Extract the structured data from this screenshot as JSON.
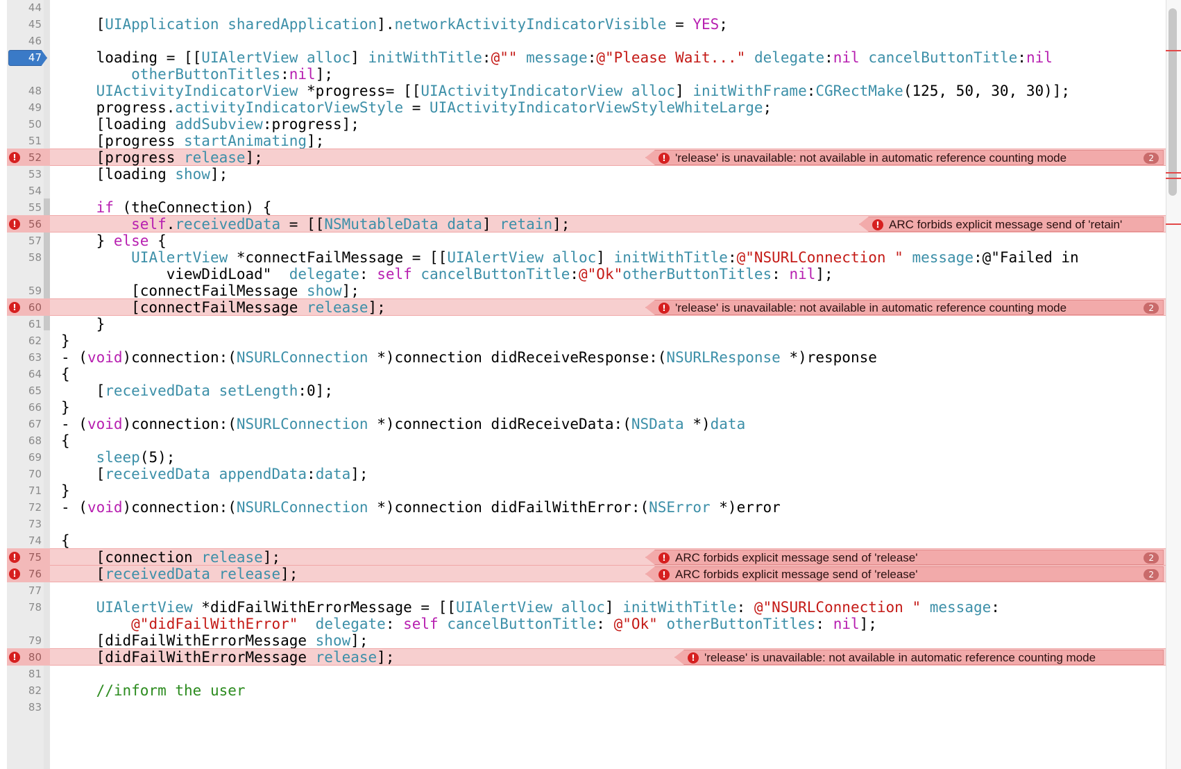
{
  "editor": {
    "lines": [
      {
        "n": "44",
        "code": ""
      },
      {
        "n": "45",
        "code": "    [UIApplication sharedApplication].networkActivityIndicatorVisible = YES;"
      },
      {
        "n": "46",
        "code": ""
      },
      {
        "n": "47",
        "code": "    loading = [[UIAlertView alloc] initWithTitle:@\"\" message:@\"Please Wait...\" delegate:nil cancelButtonTitle:nil"
      },
      {
        "n": "",
        "code": "        otherButtonTitles:nil];"
      },
      {
        "n": "48",
        "code": "    UIActivityIndicatorView *progress= [[UIActivityIndicatorView alloc] initWithFrame:CGRectMake(125, 50, 30, 30)];"
      },
      {
        "n": "49",
        "code": "    progress.activityIndicatorViewStyle = UIActivityIndicatorViewStyleWhiteLarge;"
      },
      {
        "n": "50",
        "code": "    [loading addSubview:progress];"
      },
      {
        "n": "51",
        "code": "    [progress startAnimating];"
      },
      {
        "n": "52",
        "code": "    [progress release];"
      },
      {
        "n": "53",
        "code": "    [loading show];"
      },
      {
        "n": "54",
        "code": ""
      },
      {
        "n": "55",
        "code": "    if (theConnection) {"
      },
      {
        "n": "56",
        "code": "        self.receivedData = [[NSMutableData data] retain];"
      },
      {
        "n": "57",
        "code": "    } else {"
      },
      {
        "n": "58",
        "code": "        UIAlertView *connectFailMessage = [[UIAlertView alloc] initWithTitle:@\"NSURLConnection \" message:@\"Failed in"
      },
      {
        "n": "",
        "code": "            viewDidLoad\"  delegate: self cancelButtonTitle:@\"Ok\"otherButtonTitles: nil];"
      },
      {
        "n": "59",
        "code": "        [connectFailMessage show];"
      },
      {
        "n": "60",
        "code": "        [connectFailMessage release];"
      },
      {
        "n": "61",
        "code": "    }"
      },
      {
        "n": "62",
        "code": "}"
      },
      {
        "n": "63",
        "code": "- (void)connection:(NSURLConnection *)connection didReceiveResponse:(NSURLResponse *)response"
      },
      {
        "n": "64",
        "code": "{"
      },
      {
        "n": "65",
        "code": "    [receivedData setLength:0];"
      },
      {
        "n": "66",
        "code": "}"
      },
      {
        "n": "67",
        "code": "- (void)connection:(NSURLConnection *)connection didReceiveData:(NSData *)data"
      },
      {
        "n": "68",
        "code": "{"
      },
      {
        "n": "69",
        "code": "    sleep(5);"
      },
      {
        "n": "70",
        "code": "    [receivedData appendData:data];"
      },
      {
        "n": "71",
        "code": "}"
      },
      {
        "n": "72",
        "code": "- (void)connection:(NSURLConnection *)connection didFailWithError:(NSError *)error"
      },
      {
        "n": "73",
        "code": ""
      },
      {
        "n": "74",
        "code": "{"
      },
      {
        "n": "75",
        "code": "    [connection release];"
      },
      {
        "n": "76",
        "code": "    [receivedData release];"
      },
      {
        "n": "77",
        "code": ""
      },
      {
        "n": "78",
        "code": "    UIAlertView *didFailWithErrorMessage = [[UIAlertView alloc] initWithTitle: @\"NSURLConnection \" message:"
      },
      {
        "n": "",
        "code": "        @\"didFailWithError\"  delegate: self cancelButtonTitle: @\"Ok\" otherButtonTitles: nil];"
      },
      {
        "n": "79",
        "code": "    [didFailWithErrorMessage show];"
      },
      {
        "n": "80",
        "code": "    [didFailWithErrorMessage release];"
      },
      {
        "n": "81",
        "code": ""
      },
      {
        "n": "82",
        "code": "    //inform the user"
      },
      {
        "n": "83",
        "code": ""
      }
    ],
    "breakpoint_line": "47",
    "errors": {
      "e52": {
        "text": "'release' is unavailable: not available in automatic reference counting mode",
        "count": "2"
      },
      "e56": {
        "text": "ARC forbids explicit message send of 'retain'"
      },
      "e60": {
        "text": "'release' is unavailable: not available in automatic reference counting mode",
        "count": "2"
      },
      "e75": {
        "text": "ARC forbids explicit message send of 'release'",
        "count": "2"
      },
      "e76": {
        "text": "ARC forbids explicit message send of 'release'",
        "count": "2"
      },
      "e80": {
        "text": "'release' is unavailable: not available in automatic reference counting mode"
      }
    },
    "colors": {
      "error_bg": "#f7cfcf",
      "error_bubble": "#f2aaaa",
      "error_icon": "#d61f1f",
      "breakpoint": "#3a7ac7",
      "keyword": "#b71fb0",
      "type": "#3c8fa8",
      "string": "#c41a16",
      "comment": "#2b8b1e"
    }
  }
}
